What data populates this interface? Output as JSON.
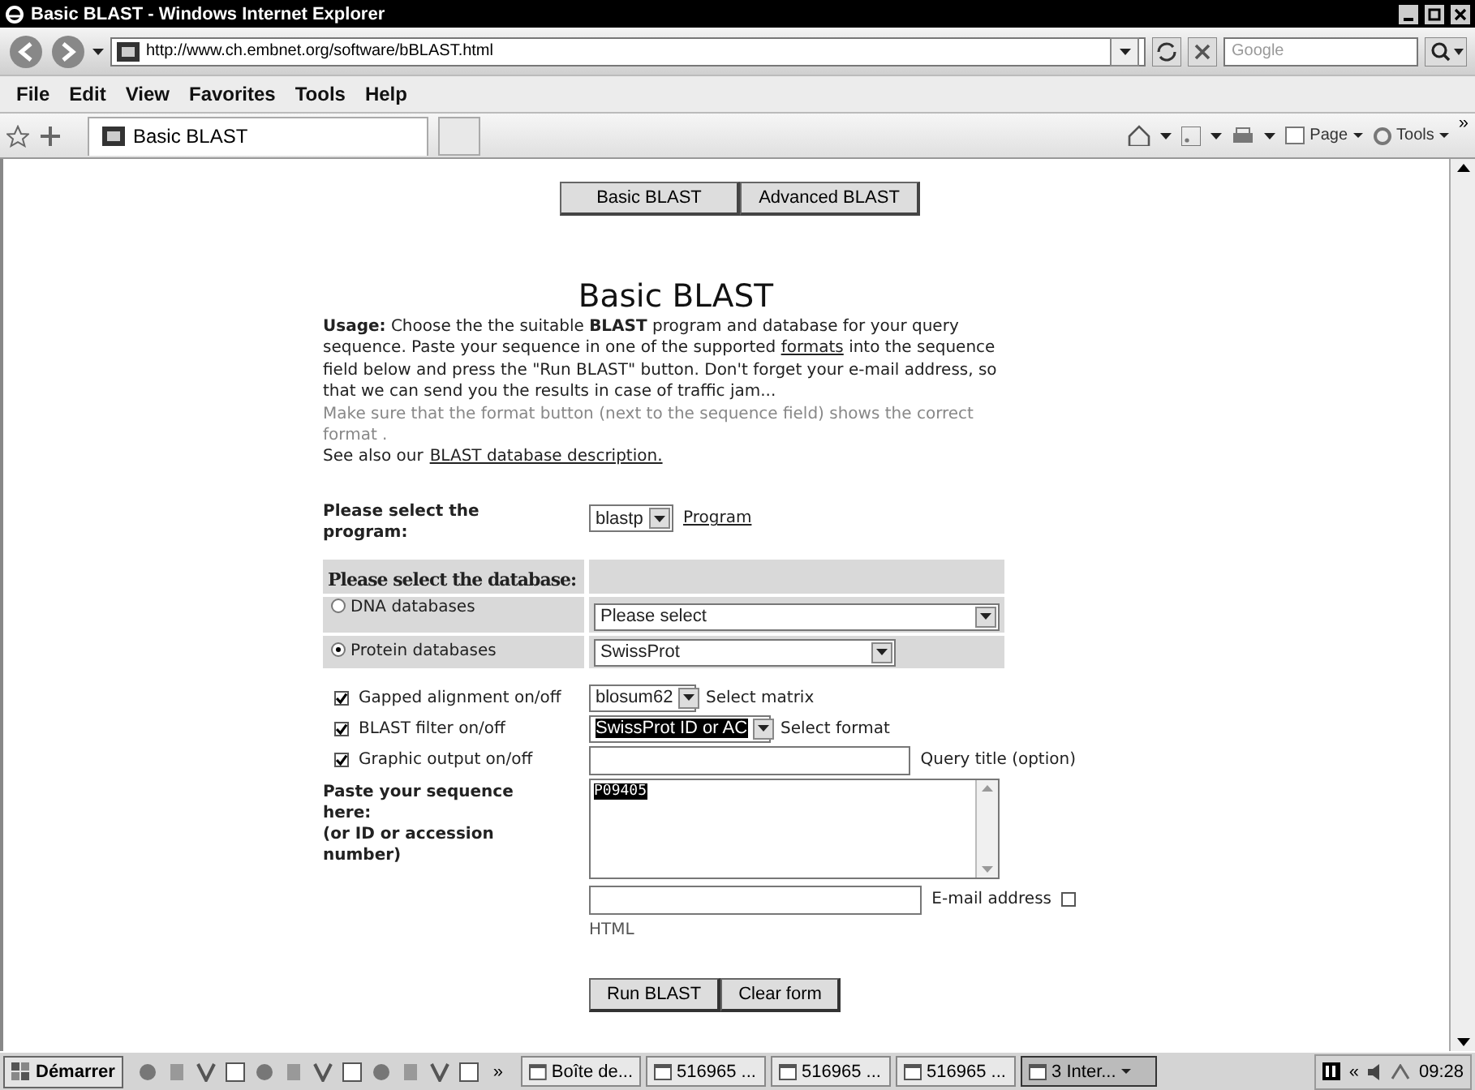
{
  "window": {
    "title": "Basic BLAST - Windows Internet Explorer"
  },
  "address_bar": {
    "url": "http://www.ch.embnet.org/software/bBLAST.html"
  },
  "search": {
    "placeholder": "Google"
  },
  "menu": [
    "File",
    "Edit",
    "View",
    "Favorites",
    "Tools",
    "Help"
  ],
  "browser_tabs": [
    {
      "label": "Basic BLAST",
      "selected": true
    }
  ],
  "command_bar": {
    "items": [
      "Page",
      "Tools"
    ],
    "more": "»"
  },
  "page": {
    "nav": [
      {
        "label": "Basic BLAST"
      },
      {
        "label": "Advanced BLAST"
      }
    ],
    "heading": "Basic BLAST",
    "usage": {
      "before": "**Usage:** Choose the the suitable **BLAST** program and database for your query sequence. Paste your sequence in one of the supported",
      "link": "formats",
      "after": "into the sequence field below and press the \"Run BLAST\" button. Don't forget your e-mail address, so that we can send you the results in case of traffic jam..."
    },
    "note": "Make sure that the format button (next to the sequence field) shows the correct format .",
    "see_also": {
      "text": "See also our",
      "link": "BLAST database description."
    },
    "program": {
      "label": "Please select the program:",
      "value": "blastp",
      "link": "Program"
    },
    "database": {
      "label": "Please select the database:",
      "options": [
        {
          "label": "DNA databases",
          "selected": false,
          "value": "Please select"
        },
        {
          "label": "Protein databases",
          "selected": true,
          "value": "SwissProt"
        }
      ]
    },
    "options": [
      {
        "kind": "select",
        "label": "Gapped alignment on/off",
        "checked": true,
        "value": "blosum62",
        "focused": false,
        "note": "Select matrix"
      },
      {
        "kind": "select",
        "label": "BLAST filter on/off",
        "checked": true,
        "value": "SwissProt ID or AC",
        "focused": true,
        "note": "Select format"
      },
      {
        "kind": "input",
        "label": "Graphic output on/off",
        "checked": true,
        "note": "Query title (option)"
      }
    ],
    "sequence": {
      "label": "Paste your sequence here:",
      "hint": "(or ID or accession number)",
      "value": "P09405",
      "value_selected": true
    },
    "email": {
      "label": "E-mail address",
      "html_checked": false,
      "html_label": "HTML"
    },
    "buttons": [
      "Run BLAST",
      "Clear form"
    ]
  },
  "taskbar": {
    "start": "Démarrer",
    "more": "»",
    "tasks": [
      {
        "label": "Boîte de...",
        "selected": false
      },
      {
        "label": "516965 ...",
        "selected": false
      },
      {
        "label": "516965 ...",
        "selected": false
      },
      {
        "label": "516965 ...",
        "selected": false
      },
      {
        "label": "3 Inter...",
        "selected": true
      }
    ],
    "tray_more": "«",
    "clock": "09:28"
  }
}
